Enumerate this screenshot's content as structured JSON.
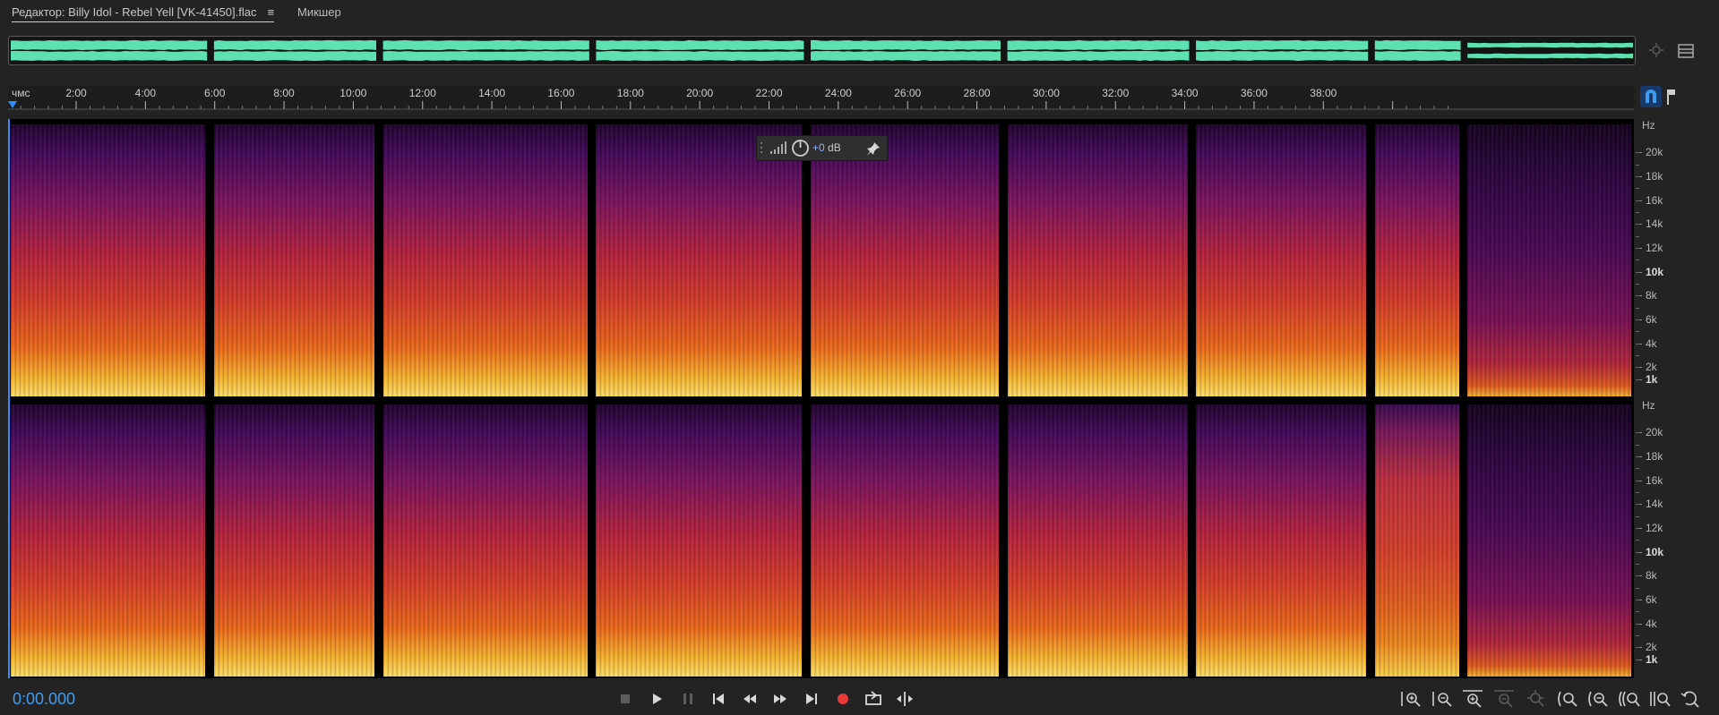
{
  "tabs": {
    "editor": "Редактор: Billy Idol - Rebel Yell [VK-41450].flac",
    "mixer": "Микшер"
  },
  "ruler": {
    "unit": "чмс",
    "labels": [
      "2:00",
      "4:00",
      "6:00",
      "8:00",
      "10:00",
      "12:00",
      "14:00",
      "16:00",
      "18:00",
      "20:00",
      "22:00",
      "24:00",
      "26:00",
      "28:00",
      "30:00",
      "32:00",
      "34:00",
      "36:00",
      "38:00"
    ]
  },
  "hud": {
    "gain_value": "+0",
    "gain_unit": "dB"
  },
  "frequency_axis": {
    "unit": "Hz",
    "labels": [
      "20k",
      "18k",
      "16k",
      "14k",
      "12k",
      "10k",
      "8k",
      "6k",
      "4k",
      "2k",
      "1k"
    ]
  },
  "transport": {
    "timecode": "0:00.000",
    "buttons": [
      "stop-icon",
      "play-icon",
      "pause-icon",
      "skip-to-start-icon",
      "rewind-icon",
      "fast-forward-icon",
      "skip-to-end-icon",
      "record-icon",
      "loop-playback-icon",
      "skip-selection-icon"
    ]
  },
  "zoom_controls": [
    "zoom-in-amplitude-icon",
    "zoom-out-amplitude-icon",
    "zoom-in-frequency-icon",
    "zoom-out-frequency-icon",
    "zoom-reset-icon",
    "zoom-in-time-icon",
    "zoom-out-time-icon",
    "zoom-out-full-icon",
    "zoom-to-selection-icon",
    "zoom-history-icon"
  ],
  "colors": {
    "waveform": "#5fe0b0",
    "timecode": "#3f9cf0",
    "playhead": "#2f8fff",
    "record": "#e83a3a"
  },
  "segments": [
    {
      "start": 0.0,
      "end": 0.123
    },
    {
      "start": 0.125,
      "end": 0.227
    },
    {
      "start": 0.229,
      "end": 0.358
    },
    {
      "start": 0.36,
      "end": 0.49
    },
    {
      "start": 0.492,
      "end": 0.611
    },
    {
      "start": 0.613,
      "end": 0.727
    },
    {
      "start": 0.729,
      "end": 0.837
    },
    {
      "start": 0.839,
      "end": 0.894
    },
    {
      "start": 0.896,
      "end": 1.0
    }
  ]
}
